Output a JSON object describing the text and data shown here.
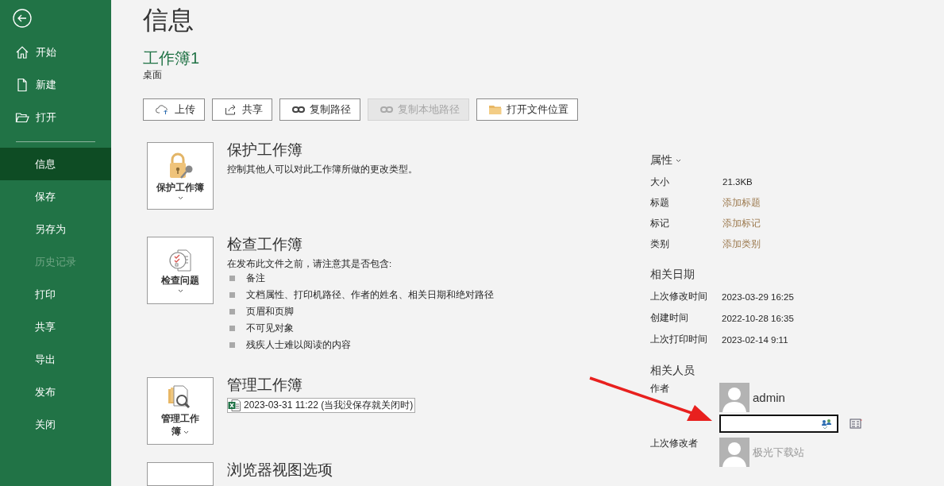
{
  "sidebar": {
    "top_items": [
      {
        "label": "开始",
        "kind": "home"
      },
      {
        "label": "新建",
        "kind": "new"
      },
      {
        "label": "打开",
        "kind": "open"
      }
    ],
    "items": [
      {
        "label": "信息",
        "selected": true,
        "disabled": false
      },
      {
        "label": "保存",
        "selected": false,
        "disabled": false
      },
      {
        "label": "另存为",
        "selected": false,
        "disabled": false
      },
      {
        "label": "历史记录",
        "selected": false,
        "disabled": true
      },
      {
        "label": "打印",
        "selected": false,
        "disabled": false
      },
      {
        "label": "共享",
        "selected": false,
        "disabled": false
      },
      {
        "label": "导出",
        "selected": false,
        "disabled": false
      },
      {
        "label": "发布",
        "selected": false,
        "disabled": false
      },
      {
        "label": "关闭",
        "selected": false,
        "disabled": false
      }
    ]
  },
  "page_title": "信息",
  "workbook": {
    "name": "工作簿1",
    "location": "桌面"
  },
  "actions": [
    {
      "label": "上传",
      "kind": "upload",
      "disabled": false
    },
    {
      "label": "共享",
      "kind": "share",
      "disabled": false
    },
    {
      "label": "复制路径",
      "kind": "link",
      "disabled": false
    },
    {
      "label": "复制本地路径",
      "kind": "link",
      "disabled": true
    },
    {
      "label": "打开文件位置",
      "kind": "folder",
      "disabled": false
    }
  ],
  "sections": [
    {
      "kind": "protect",
      "button_label": "保护工作簿",
      "title": "保护工作簿",
      "description": "控制其他人可以对此工作簿所做的更改类型。"
    },
    {
      "kind": "inspect",
      "button_label": "检查问题",
      "title": "检查工作簿",
      "description": "在发布此文件之前，请注意其是否包含:",
      "bullets": [
        "备注",
        "文档属性、打印机路径、作者的姓名、相关日期和绝对路径",
        "页眉和页脚",
        "不可见对象",
        "残疾人士难以阅读的内容"
      ]
    },
    {
      "kind": "manage",
      "button_label": "管理工作簿",
      "title": "管理工作簿",
      "versions": [
        "2023-03-31 11:22 (当我没保存就关闭时)"
      ]
    },
    {
      "kind": "browser",
      "title": "浏览器视图选项"
    }
  ],
  "properties": {
    "heading": "属性",
    "rows": [
      {
        "label": "大小",
        "value": "21.3KB",
        "kind": "value"
      },
      {
        "label": "标题",
        "value": "添加标题",
        "kind": "link"
      },
      {
        "label": "标记",
        "value": "添加标记",
        "kind": "link"
      },
      {
        "label": "类别",
        "value": "添加类别",
        "kind": "link"
      }
    ]
  },
  "dates": {
    "heading": "相关日期",
    "rows": [
      {
        "label": "上次修改时间",
        "value": "2023-03-29 16:25"
      },
      {
        "label": "创建时间",
        "value": "2022-10-28 16:35"
      },
      {
        "label": "上次打印时间",
        "value": "2023-02-14 9:11"
      }
    ]
  },
  "people": {
    "heading": "相关人员",
    "author_label": "作者",
    "author": "admin",
    "last_modified_label": "上次修改者",
    "last_modified_by": "极光下载站"
  }
}
